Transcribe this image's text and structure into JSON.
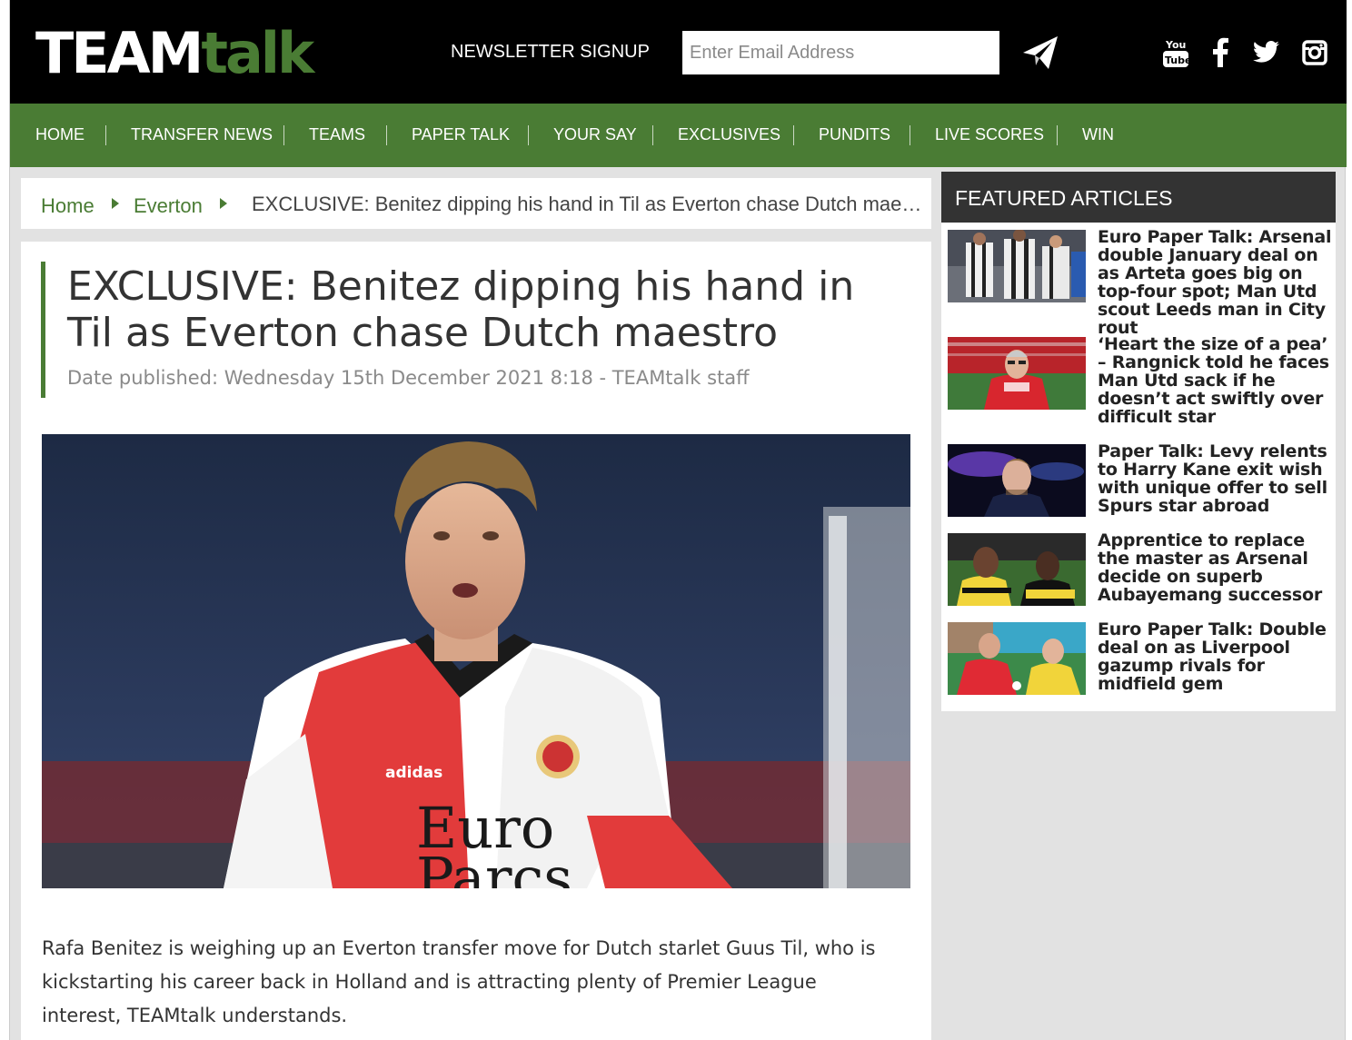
{
  "header": {
    "logo_part1": "TEAM",
    "logo_part2": "talk",
    "newsletter_label": "NEWSLETTER SIGNUP",
    "email_placeholder": "Enter Email Address",
    "social_icons": [
      "youtube-icon",
      "facebook-icon",
      "twitter-icon",
      "instagram-icon"
    ]
  },
  "nav": {
    "items": [
      "HOME",
      "TRANSFER NEWS",
      "TEAMS",
      "PAPER TALK",
      "YOUR SAY",
      "EXCLUSIVES",
      "PUNDITS",
      "LIVE SCORES",
      "WIN"
    ]
  },
  "breadcrumb": {
    "home": "Home",
    "section": "Everton",
    "current": "EXCLUSIVE: Benitez dipping his hand in Til as Everton chase Dutch maestro"
  },
  "article": {
    "title": "EXCLUSIVE: Benitez dipping his hand in Til as Everton chase Dutch maestro",
    "date": "Date published: Wednesday 15th December 2021 8:18 - TEAMtalk staff",
    "hero_shirt_text_1": "Euro",
    "hero_shirt_text_2": "Parcs",
    "hero_brand": "adidas",
    "body": "Rafa Benitez is weighing up an Everton transfer move for Dutch starlet Guus Til, who is kickstarting his career back in Holland and is attracting plenty of Premier League interest, TEAMtalk understands."
  },
  "sidebar": {
    "heading": "FEATURED ARTICLES",
    "articles": [
      {
        "title": "Euro Paper Talk: Arsenal double January deal on as Arteta goes big on top-four spot; Man Utd scout Leeds man in City rout"
      },
      {
        "title": "‘Heart the size of a pea’ – Rangnick told he faces Man Utd sack if he doesn’t act swiftly over difficult star"
      },
      {
        "title": "Paper Talk: Levy relents to Harry Kane exit wish with unique offer to sell Spurs star abroad"
      },
      {
        "title": "Apprentice to replace the master as Arsenal decide on superb Aubayemang successor"
      },
      {
        "title": "Euro Paper Talk: Double deal on as Liverpool gazump rivals for midfield gem"
      }
    ]
  },
  "colors": {
    "brand_green": "#4a7c34",
    "header_black": "#000000",
    "sidebar_head": "#333333"
  }
}
